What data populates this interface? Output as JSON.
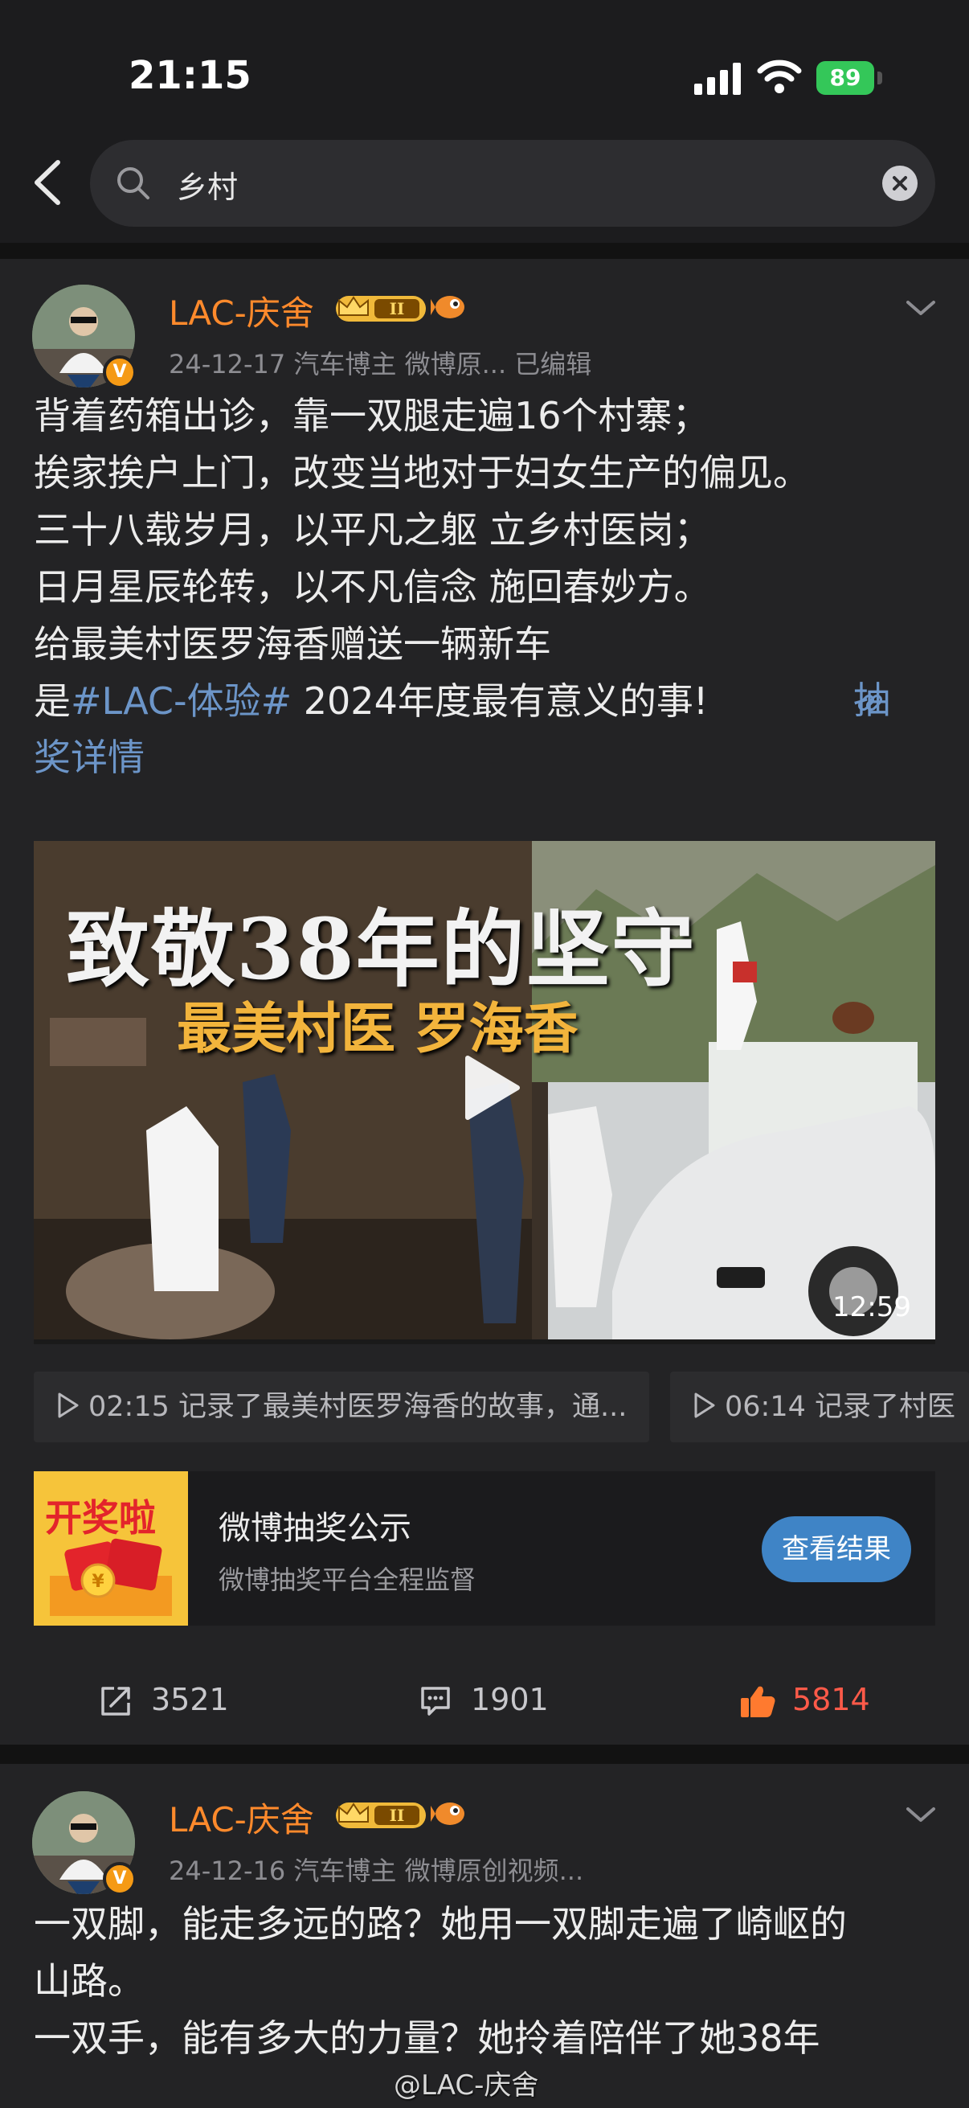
{
  "status_bar": {
    "time": "21:15",
    "battery": "89"
  },
  "search": {
    "query": "乡村"
  },
  "posts": [
    {
      "author": "LAC-庆舍",
      "level_badge": "II",
      "meta": "24-12-17  汽车博主 微博原...  已编辑",
      "text_lines": [
        "背着药箱出诊，靠一双腿走遍16个村寨；",
        "挨家挨户上门，改变当地对于妇女生产的偏见。",
        "三十八载岁月，以平凡之躯  立乡村医岗；",
        "日月星辰轮转，以不凡信念  施回春妙方。",
        "给最美村医罗海香赠送一辆新车"
      ],
      "text_prefix": "是",
      "hashtag": "#LAC-体验#",
      "text_suffix": " 2024年度最有意义的事!",
      "link_label": "抽奖详情",
      "video": {
        "title_line1": "致敬38年的坚守",
        "title_line2": "最美村医 罗海香",
        "duration": "12:59"
      },
      "chapters": [
        "02:15 记录了最美村医罗海香的故事，通...",
        "06:14 记录了村医"
      ],
      "lottery": {
        "badge_text": "开奖啦",
        "title": "微博抽奖公示",
        "subtitle": "微博抽奖平台全程监督",
        "button": "查看结果"
      },
      "stats": {
        "reposts": "3521",
        "comments": "1901",
        "likes": "5814"
      }
    },
    {
      "author": "LAC-庆舍",
      "level_badge": "II",
      "meta": "24-12-16  汽车博主 微博原创视频...",
      "text_lines": [
        "一双脚，能走多远的路？她用一双脚走遍了崎岖的",
        "山路。",
        "一双手，能有多大的力量？她拎着陪伴了她38年"
      ]
    }
  ],
  "watermark": "@LAC-庆舍",
  "colors": {
    "accent_orange": "#ff8a2c",
    "link_blue": "#6c95c8",
    "like_red": "#ff5a49",
    "button_blue": "#3f84c6"
  }
}
